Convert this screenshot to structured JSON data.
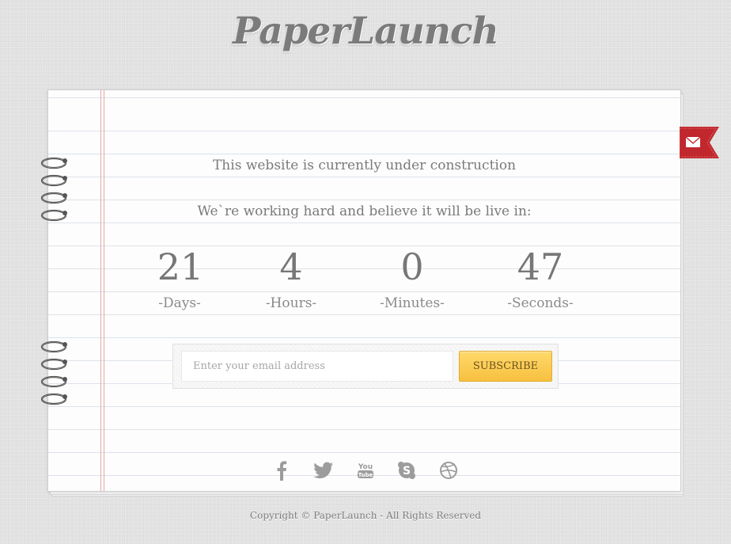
{
  "brand": {
    "title": "PaperLaunch"
  },
  "notice": {
    "construction": "This website is currently under construction",
    "working": "We`re working hard and believe it will be live in:"
  },
  "countdown": [
    {
      "value": "21",
      "label": "-Days-"
    },
    {
      "value": "4",
      "label": "-Hours-"
    },
    {
      "value": "0",
      "label": "-Minutes-"
    },
    {
      "value": "47",
      "label": "-Seconds-"
    }
  ],
  "subscribe": {
    "placeholder": "Enter your email address",
    "button_label": "SUBSCRIBE"
  },
  "social_icons": [
    "facebook-icon",
    "twitter-icon",
    "youtube-icon",
    "skype-icon",
    "dribbble-icon"
  ],
  "youtube_text": "You Tube",
  "footer": {
    "copyright": "Copyright © PaperLaunch - All Rights Reserved"
  },
  "colors": {
    "ribbon": "#c0282d",
    "button": "#f7c03f",
    "margin_line": "#e3a7a7"
  }
}
